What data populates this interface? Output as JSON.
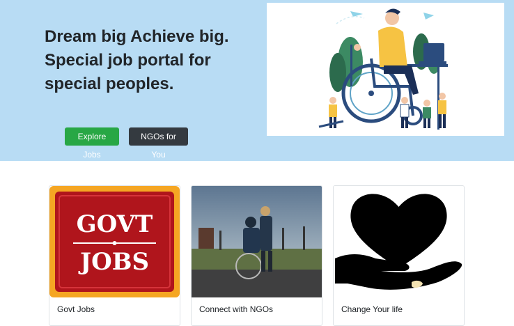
{
  "hero": {
    "headline_lines": [
      "Dream big Achieve big.",
      "Special job portal for",
      "special peoples."
    ],
    "explore_button": "Explore Jobs",
    "ngo_button": "NGOs for You"
  },
  "cards": [
    {
      "title": "Govt Jobs",
      "image_text_line1": "GOVT",
      "image_text_line2": "JOBS"
    },
    {
      "title": "Connect with NGOs"
    },
    {
      "title": "Change Your life"
    }
  ],
  "colors": {
    "hero_bg": "#b8dcf4",
    "explore_button": "#28a745",
    "ngo_button": "#343a40",
    "govt_badge_red": "#b0151c",
    "govt_badge_gold": "#f5a623"
  }
}
